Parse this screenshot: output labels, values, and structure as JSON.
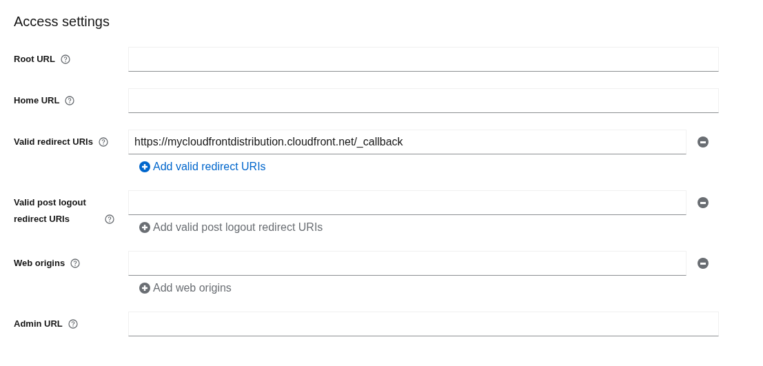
{
  "title": "Access settings",
  "fields": [
    {
      "label": "Root URL",
      "kind": "single"
    },
    {
      "label": "Home URL",
      "kind": "single"
    },
    {
      "label": "Valid redirect URIs",
      "kind": "multi",
      "value": "https://mycloudfrontdistribution.cloudfront.net/_callback",
      "add_link": {
        "label": "Add valid redirect URIs",
        "disabled": false
      }
    },
    {
      "label": "Valid post logout redirect URIs",
      "kind": "multi",
      "add_link": {
        "label": "Add valid post logout redirect URIs",
        "disabled": true
      }
    },
    {
      "label": "Web origins",
      "kind": "multi",
      "add_link": {
        "label": "Add web origins",
        "disabled": true
      }
    },
    {
      "label": "Admin URL",
      "kind": "single"
    }
  ]
}
